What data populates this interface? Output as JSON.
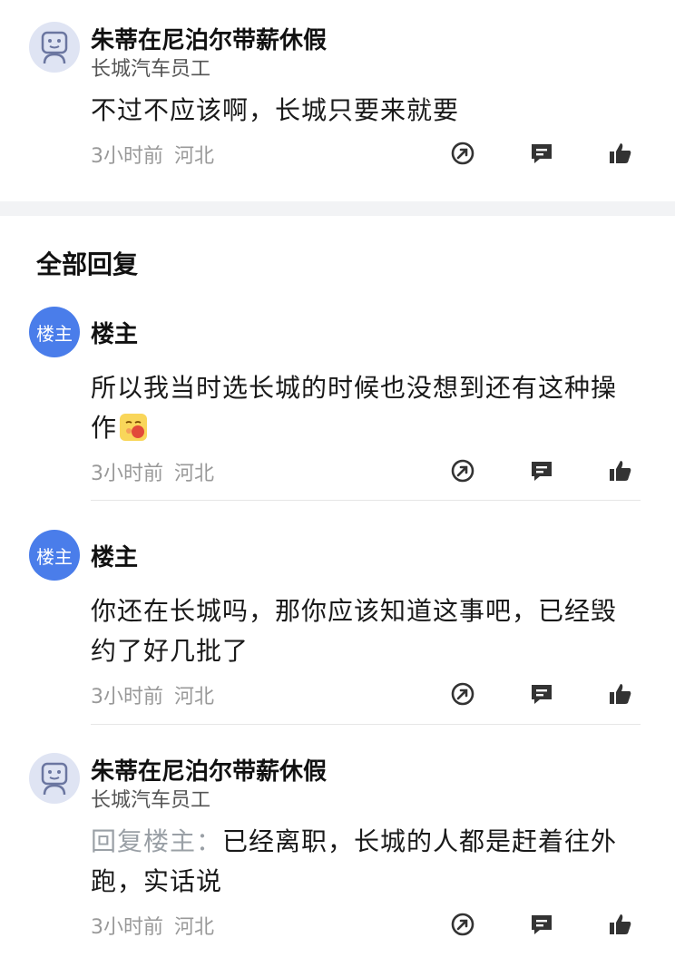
{
  "comments": [
    {
      "name": "朱蒂在尼泊尔带薪休假",
      "subtitle": "长城汽车员工",
      "text": "不过不应该啊，长城只要来就要",
      "time": "3小时前",
      "location": "河北"
    },
    {
      "name": "楼主",
      "avatar_label": "楼主",
      "text": "所以我当时选长城的时候也没想到还有这种操作",
      "time": "3小时前",
      "location": "河北"
    },
    {
      "name": "楼主",
      "avatar_label": "楼主",
      "text": "你还在长城吗，那你应该知道这事吧，已经毁约了好几批了",
      "time": "3小时前",
      "location": "河北"
    },
    {
      "name": "朱蒂在尼泊尔带薪休假",
      "subtitle": "长城汽车员工",
      "reply_prefix": "回复楼主：",
      "text": "已经离职，长城的人都是赶着往外跑，实话说",
      "time": "3小时前",
      "location": "河北"
    }
  ],
  "section": {
    "title": "全部回复"
  },
  "icons": {
    "share": "share-icon",
    "comment": "comment-icon",
    "like": "thumbs-up-icon",
    "avatar": "robot-avatar-icon"
  },
  "colors": {
    "op_avatar": "#4a7dea",
    "icon": "#333333",
    "meta": "#999999"
  }
}
